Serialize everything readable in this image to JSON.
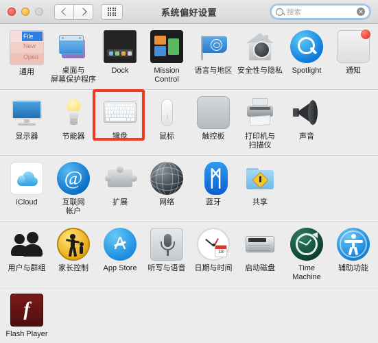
{
  "window": {
    "title": "系统偏好设置",
    "traffic_lights": [
      "close",
      "minimize",
      "zoom-disabled"
    ],
    "nav": {
      "back_label": "‹",
      "forward_label": "›",
      "grid_label": "show-all-grid"
    },
    "search": {
      "placeholder": "搜索",
      "value": "",
      "clear_label": "✕"
    }
  },
  "highlight": {
    "target": "键盘",
    "color": "#f03b24"
  },
  "rows": [
    {
      "name": "personal",
      "items": [
        {
          "label": "通用",
          "icon": "general-icon"
        },
        {
          "label": "桌面与\n屏幕保护程序",
          "label_line1": "桌面与",
          "label_line2": "屏幕保护程序",
          "icon": "desktop-screensaver-icon"
        },
        {
          "label": "Dock",
          "icon": "dock-icon"
        },
        {
          "label": "Mission\nControl",
          "label_line1": "Mission",
          "label_line2": "Control",
          "icon": "mission-control-icon"
        },
        {
          "label": "语言与地区",
          "icon": "language-region-icon"
        },
        {
          "label": "安全性与隐私",
          "icon": "security-privacy-icon"
        },
        {
          "label": "Spotlight",
          "icon": "spotlight-icon"
        },
        {
          "label": "通知",
          "icon": "notifications-icon"
        }
      ]
    },
    {
      "name": "hardware",
      "items": [
        {
          "label": "显示器",
          "icon": "displays-icon"
        },
        {
          "label": "节能器",
          "icon": "energy-saver-icon"
        },
        {
          "label": "键盘",
          "icon": "keyboard-icon",
          "selected": true
        },
        {
          "label": "鼠标",
          "icon": "mouse-icon"
        },
        {
          "label": "触控板",
          "icon": "trackpad-icon"
        },
        {
          "label": "打印机与\n扫描仪",
          "label_line1": "打印机与",
          "label_line2": "扫描仪",
          "icon": "printers-scanners-icon"
        },
        {
          "label": "声音",
          "icon": "sound-icon"
        }
      ]
    },
    {
      "name": "internet-wireless",
      "items": [
        {
          "label": "iCloud",
          "icon": "icloud-icon"
        },
        {
          "label": "互联网\n帐户",
          "label_line1": "互联网",
          "label_line2": "帐户",
          "icon": "internet-accounts-icon"
        },
        {
          "label": "扩展",
          "icon": "extensions-icon"
        },
        {
          "label": "网络",
          "icon": "network-icon"
        },
        {
          "label": "蓝牙",
          "icon": "bluetooth-icon"
        },
        {
          "label": "共享",
          "icon": "sharing-icon"
        }
      ]
    },
    {
      "name": "system",
      "items": [
        {
          "label": "用户与群组",
          "icon": "users-groups-icon"
        },
        {
          "label": "家长控制",
          "icon": "parental-controls-icon"
        },
        {
          "label": "App Store",
          "icon": "app-store-icon"
        },
        {
          "label": "听写与语音",
          "icon": "dictation-speech-icon"
        },
        {
          "label": "日期与时间",
          "icon": "date-time-icon"
        },
        {
          "label": "启动磁盘",
          "icon": "startup-disk-icon"
        },
        {
          "label": "Time Machine",
          "icon": "time-machine-icon"
        },
        {
          "label": "辅助功能",
          "icon": "accessibility-icon"
        }
      ]
    },
    {
      "name": "third-party",
      "items": [
        {
          "label": "Flash Player",
          "icon": "flash-player-icon"
        }
      ]
    }
  ],
  "icon_details": {
    "general_menu_text": {
      "line1": "File",
      "line2": "New",
      "line3": "Open"
    },
    "internet_at_symbol": "@",
    "bluetooth_rune": "ᛗ",
    "app_store_letter": "A",
    "flash_letter": "f",
    "date_day": "18"
  }
}
